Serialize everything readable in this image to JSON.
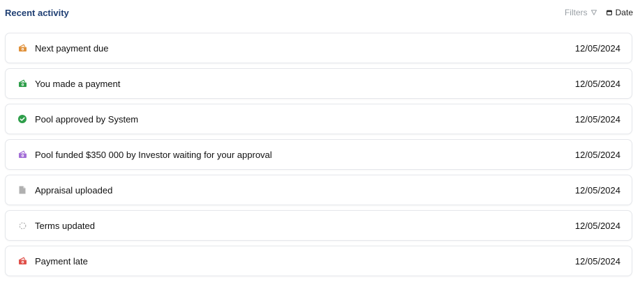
{
  "header": {
    "title": "Recent activity",
    "filters_label": "Filters",
    "date_label": "Date"
  },
  "activities": [
    {
      "label": "Next payment due",
      "date": "12/05/2024",
      "icon": "money-icon",
      "color": "#e0913a"
    },
    {
      "label": "You made a payment",
      "date": "12/05/2024",
      "icon": "money-icon",
      "color": "#2e9e4a"
    },
    {
      "label": "Pool approved by System",
      "date": "12/05/2024",
      "icon": "check-circle-icon",
      "color": "#2e9e4a"
    },
    {
      "label": "Pool funded $350 000 by Investor waiting for your approval",
      "date": "12/05/2024",
      "icon": "money-icon",
      "color": "#a36ed6"
    },
    {
      "label": "Appraisal uploaded",
      "date": "12/05/2024",
      "icon": "document-icon",
      "color": "#b0b0b0"
    },
    {
      "label": "Terms updated",
      "date": "12/05/2024",
      "icon": "loading-circle-icon",
      "color": "#b0b0b0"
    },
    {
      "label": "Payment late",
      "date": "12/05/2024",
      "icon": "money-icon",
      "color": "#e0504a"
    }
  ]
}
